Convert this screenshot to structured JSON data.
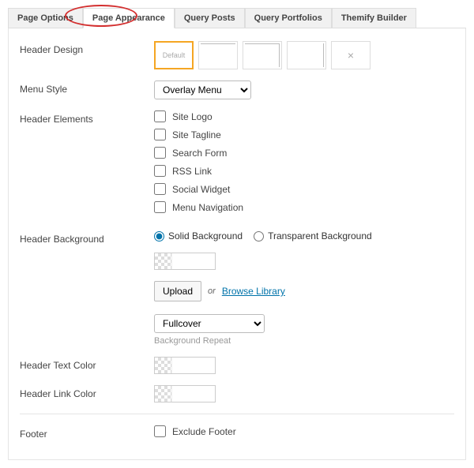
{
  "tabs": {
    "page_options": "Page Options",
    "page_appearance": "Page Appearance",
    "query_posts": "Query Posts",
    "query_portfolios": "Query Portfolios",
    "themify_builder": "Themify Builder"
  },
  "labels": {
    "header_design": "Header Design",
    "menu_style": "Menu Style",
    "header_elements": "Header Elements",
    "header_background": "Header Background",
    "header_text_color": "Header Text Color",
    "header_link_color": "Header Link Color",
    "footer": "Footer"
  },
  "header_design": {
    "default_label": "Default"
  },
  "menu_style": {
    "selected": "Overlay Menu"
  },
  "header_elements": {
    "site_logo": "Site Logo",
    "site_tagline": "Site Tagline",
    "search_form": "Search Form",
    "rss_link": "RSS Link",
    "social_widget": "Social Widget",
    "menu_navigation": "Menu Navigation"
  },
  "header_background": {
    "solid": "Solid Background",
    "transparent": "Transparent Background",
    "upload": "Upload",
    "or": "or",
    "browse": "Browse Library",
    "repeat_selected": "Fullcover",
    "repeat_helper": "Background Repeat"
  },
  "footer_fields": {
    "exclude": "Exclude Footer"
  }
}
